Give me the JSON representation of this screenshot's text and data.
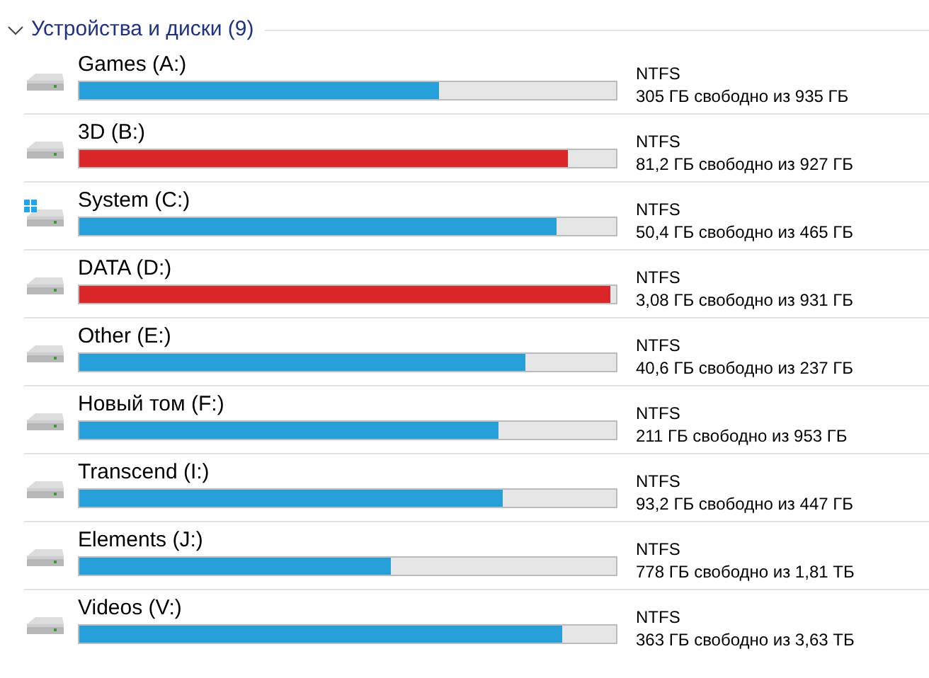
{
  "group": {
    "title": "Устройства и диски (9)",
    "expanded": true
  },
  "drives": [
    {
      "name": "Games (A:)",
      "kind": "drive",
      "level": 0.67,
      "warning": false,
      "filesystem": "NTFS",
      "free": "305 ГБ свободно из 935 ГБ"
    },
    {
      "name": "3D (B:)",
      "kind": "drive",
      "level": 0.91,
      "warning": true,
      "filesystem": "NTFS",
      "free": "81,2 ГБ свободно из 927 ГБ"
    },
    {
      "name": "System (C:)",
      "kind": "system",
      "level": 0.89,
      "warning": false,
      "filesystem": "NTFS",
      "free": "50,4 ГБ свободно из 465 ГБ"
    },
    {
      "name": "DATA (D:)",
      "kind": "drive",
      "level": 0.99,
      "warning": true,
      "filesystem": "NTFS",
      "free": "3,08 ГБ свободно из 931 ГБ"
    },
    {
      "name": "Other (E:)",
      "kind": "drive",
      "level": 0.83,
      "warning": false,
      "filesystem": "NTFS",
      "free": "40,6 ГБ свободно из 237 ГБ"
    },
    {
      "name": "Новый том (F:)",
      "kind": "drive",
      "level": 0.78,
      "warning": false,
      "filesystem": "NTFS",
      "free": "211 ГБ свободно из 953 ГБ"
    },
    {
      "name": "Transcend (I:)",
      "kind": "drive",
      "level": 0.79,
      "warning": false,
      "filesystem": "NTFS",
      "free": "93,2 ГБ свободно из 447 ГБ"
    },
    {
      "name": "Elements (J:)",
      "kind": "drive",
      "level": 0.58,
      "warning": false,
      "filesystem": "NTFS",
      "free": "778 ГБ свободно из 1,81 ТБ"
    },
    {
      "name": "Videos (V:)",
      "kind": "drive",
      "level": 0.9,
      "warning": false,
      "filesystem": "NTFS",
      "free": "363 ГБ свободно из 3,63 ТБ"
    }
  ]
}
